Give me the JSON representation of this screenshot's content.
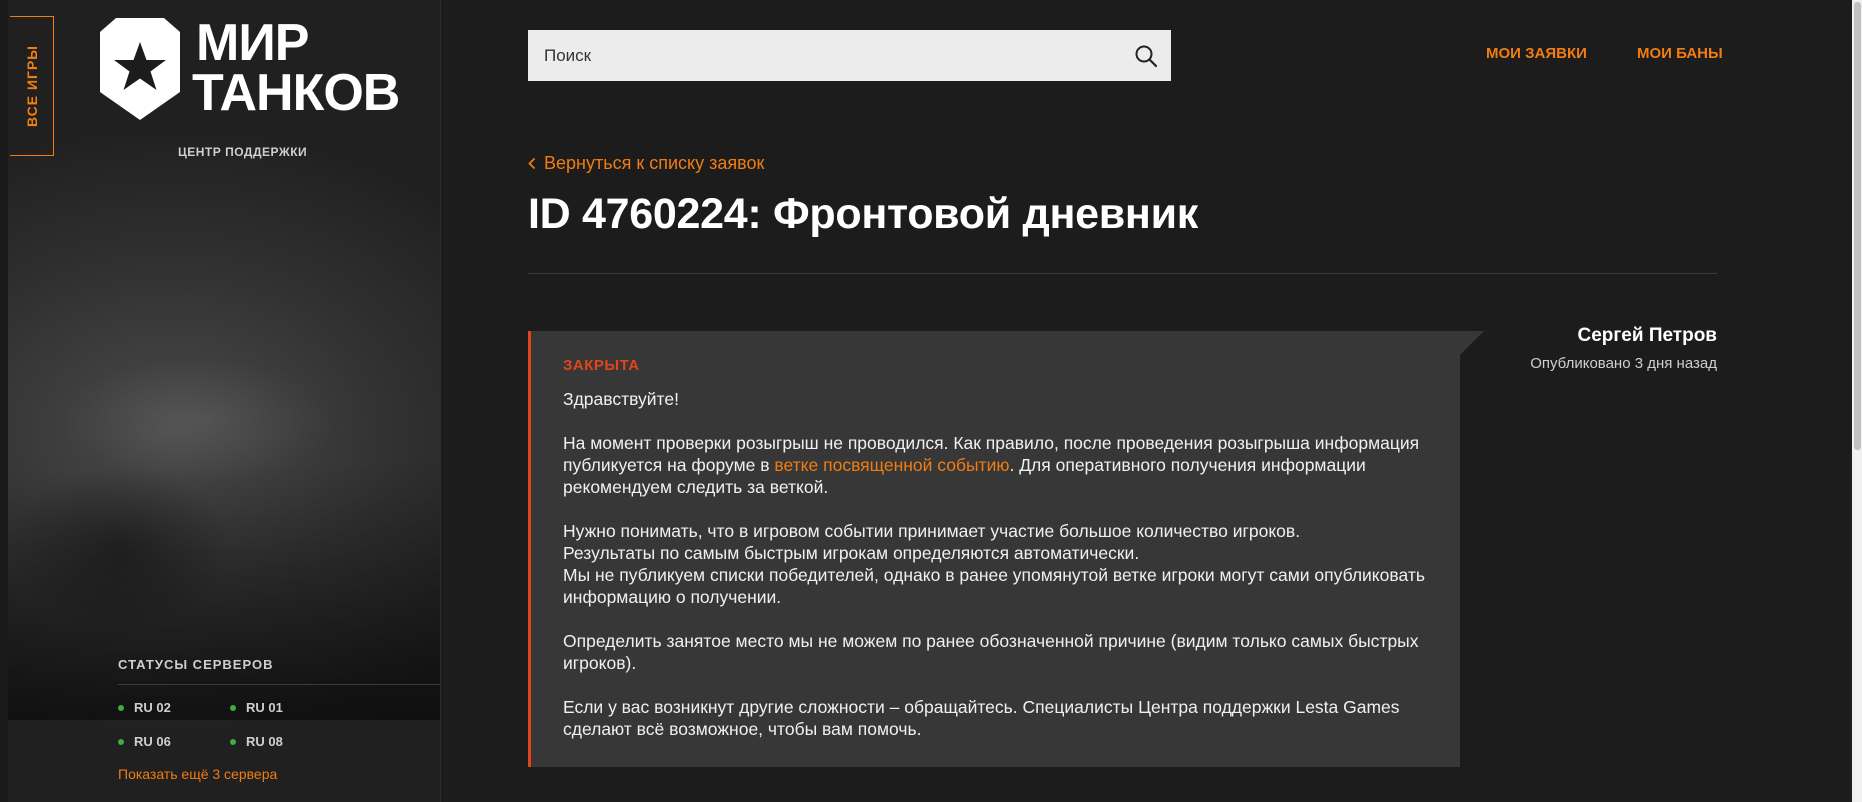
{
  "sidebar": {
    "all_games": "ВСЕ ИГРЫ",
    "logo_line1": "МИР",
    "logo_line2": "ТАНКОВ",
    "support_center": "ЦЕНТР ПОДДЕРЖКИ",
    "server_status_title": "СТАТУСЫ СЕРВЕРОВ",
    "servers": [
      {
        "name": "RU 02",
        "status": "online"
      },
      {
        "name": "RU 01",
        "status": "online"
      },
      {
        "name": "RU 06",
        "status": "online"
      },
      {
        "name": "RU 08",
        "status": "online"
      }
    ],
    "show_more": "Показать ещё 3 сервера"
  },
  "header": {
    "search_placeholder": "Поиск",
    "my_tickets": "МОИ ЗАЯВКИ",
    "my_bans": "МОИ БАНЫ"
  },
  "main": {
    "back_link": "Вернуться к списку заявок",
    "title": "ID 4760224: Фронтовой дневник",
    "ticket": {
      "status": "ЗАКРЫТА",
      "greeting": "Здравствуйте!",
      "p1_before": "На момент проверки розыгрыш не проводился. Как правило, после проведения розыгрыша информация публикуется на форуме в ",
      "p1_link": "ветке посвященной событию",
      "p1_after": ". Для оперативного получения информации рекомендуем следить за веткой.",
      "p2_line1": "Нужно понимать, что в игровом событии принимает участие большое количество игроков.",
      "p2_line2": "Результаты по самым быстрым игрокам определяются автоматически.",
      "p2_line3": "Мы не публикуем списки победителей, однако в ранее упомянутой ветке игроки могут сами опубликовать информацию о получении.",
      "p3": "Определить занятое место мы не можем по ранее обозначенной причине (видим только самых быстрых игроков).",
      "p4": "Если у вас возникнут другие сложности – обращайтесь. Специалисты Центра поддержки Lesta Games сделают всё возможное, чтобы вам помочь."
    },
    "author": {
      "name": "Сергей Петров",
      "published": "Опубликовано 3 дня назад"
    }
  },
  "colors": {
    "accent": "#f07d12",
    "closed_status": "#e0451b",
    "server_online": "#3fae3f"
  }
}
